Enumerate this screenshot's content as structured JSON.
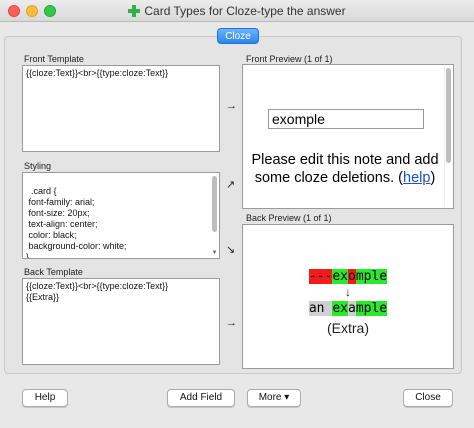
{
  "window": {
    "title": "Card Types for Cloze-type the answer"
  },
  "card_type_tab": "Cloze",
  "front_template": {
    "label": "Front Template",
    "content": "{{cloze:Text}}<br>{{type:cloze:Text}}"
  },
  "styling": {
    "label": "Styling",
    "content": ".card {\n font-family: arial;\n font-size: 20px;\n text-align: center;\n color: black;\n background-color: white;\n}"
  },
  "back_template": {
    "label": "Back Template",
    "content": "{{cloze:Text}}<br>{{type:cloze:Text}}\n{{Extra}}"
  },
  "front_preview": {
    "label": "Front Preview (1 of 1)",
    "input_value": "exomple",
    "message_before": "Please edit this note and add some cloze deletions. (",
    "link": "help",
    "message_after": ")"
  },
  "back_preview": {
    "label": "Back Preview (1 of 1)",
    "typed_segments": [
      {
        "text": "---",
        "status": "bad"
      },
      {
        "text": "ex",
        "status": "good"
      },
      {
        "text": "o",
        "status": "bad"
      },
      {
        "text": "mple",
        "status": "good"
      }
    ],
    "arrow": "↓",
    "expected_segments": [
      {
        "text": "an ",
        "status": "miss"
      },
      {
        "text": "ex",
        "status": "good"
      },
      {
        "text": "a",
        "status": "miss"
      },
      {
        "text": "mple",
        "status": "good"
      }
    ],
    "extra": "(Extra)"
  },
  "arrows": {
    "front": "→",
    "styling_up": "↗",
    "styling_down": "↘",
    "back": "→"
  },
  "buttons": {
    "help": "Help",
    "add_field": "Add Field",
    "more": "More ▾",
    "close": "Close"
  },
  "colors": {
    "bad": "#f41b1b",
    "good": "#2ce82c",
    "miss": "#d0d0d0",
    "link": "#1a4fd6",
    "accent": "#2a86ef"
  }
}
